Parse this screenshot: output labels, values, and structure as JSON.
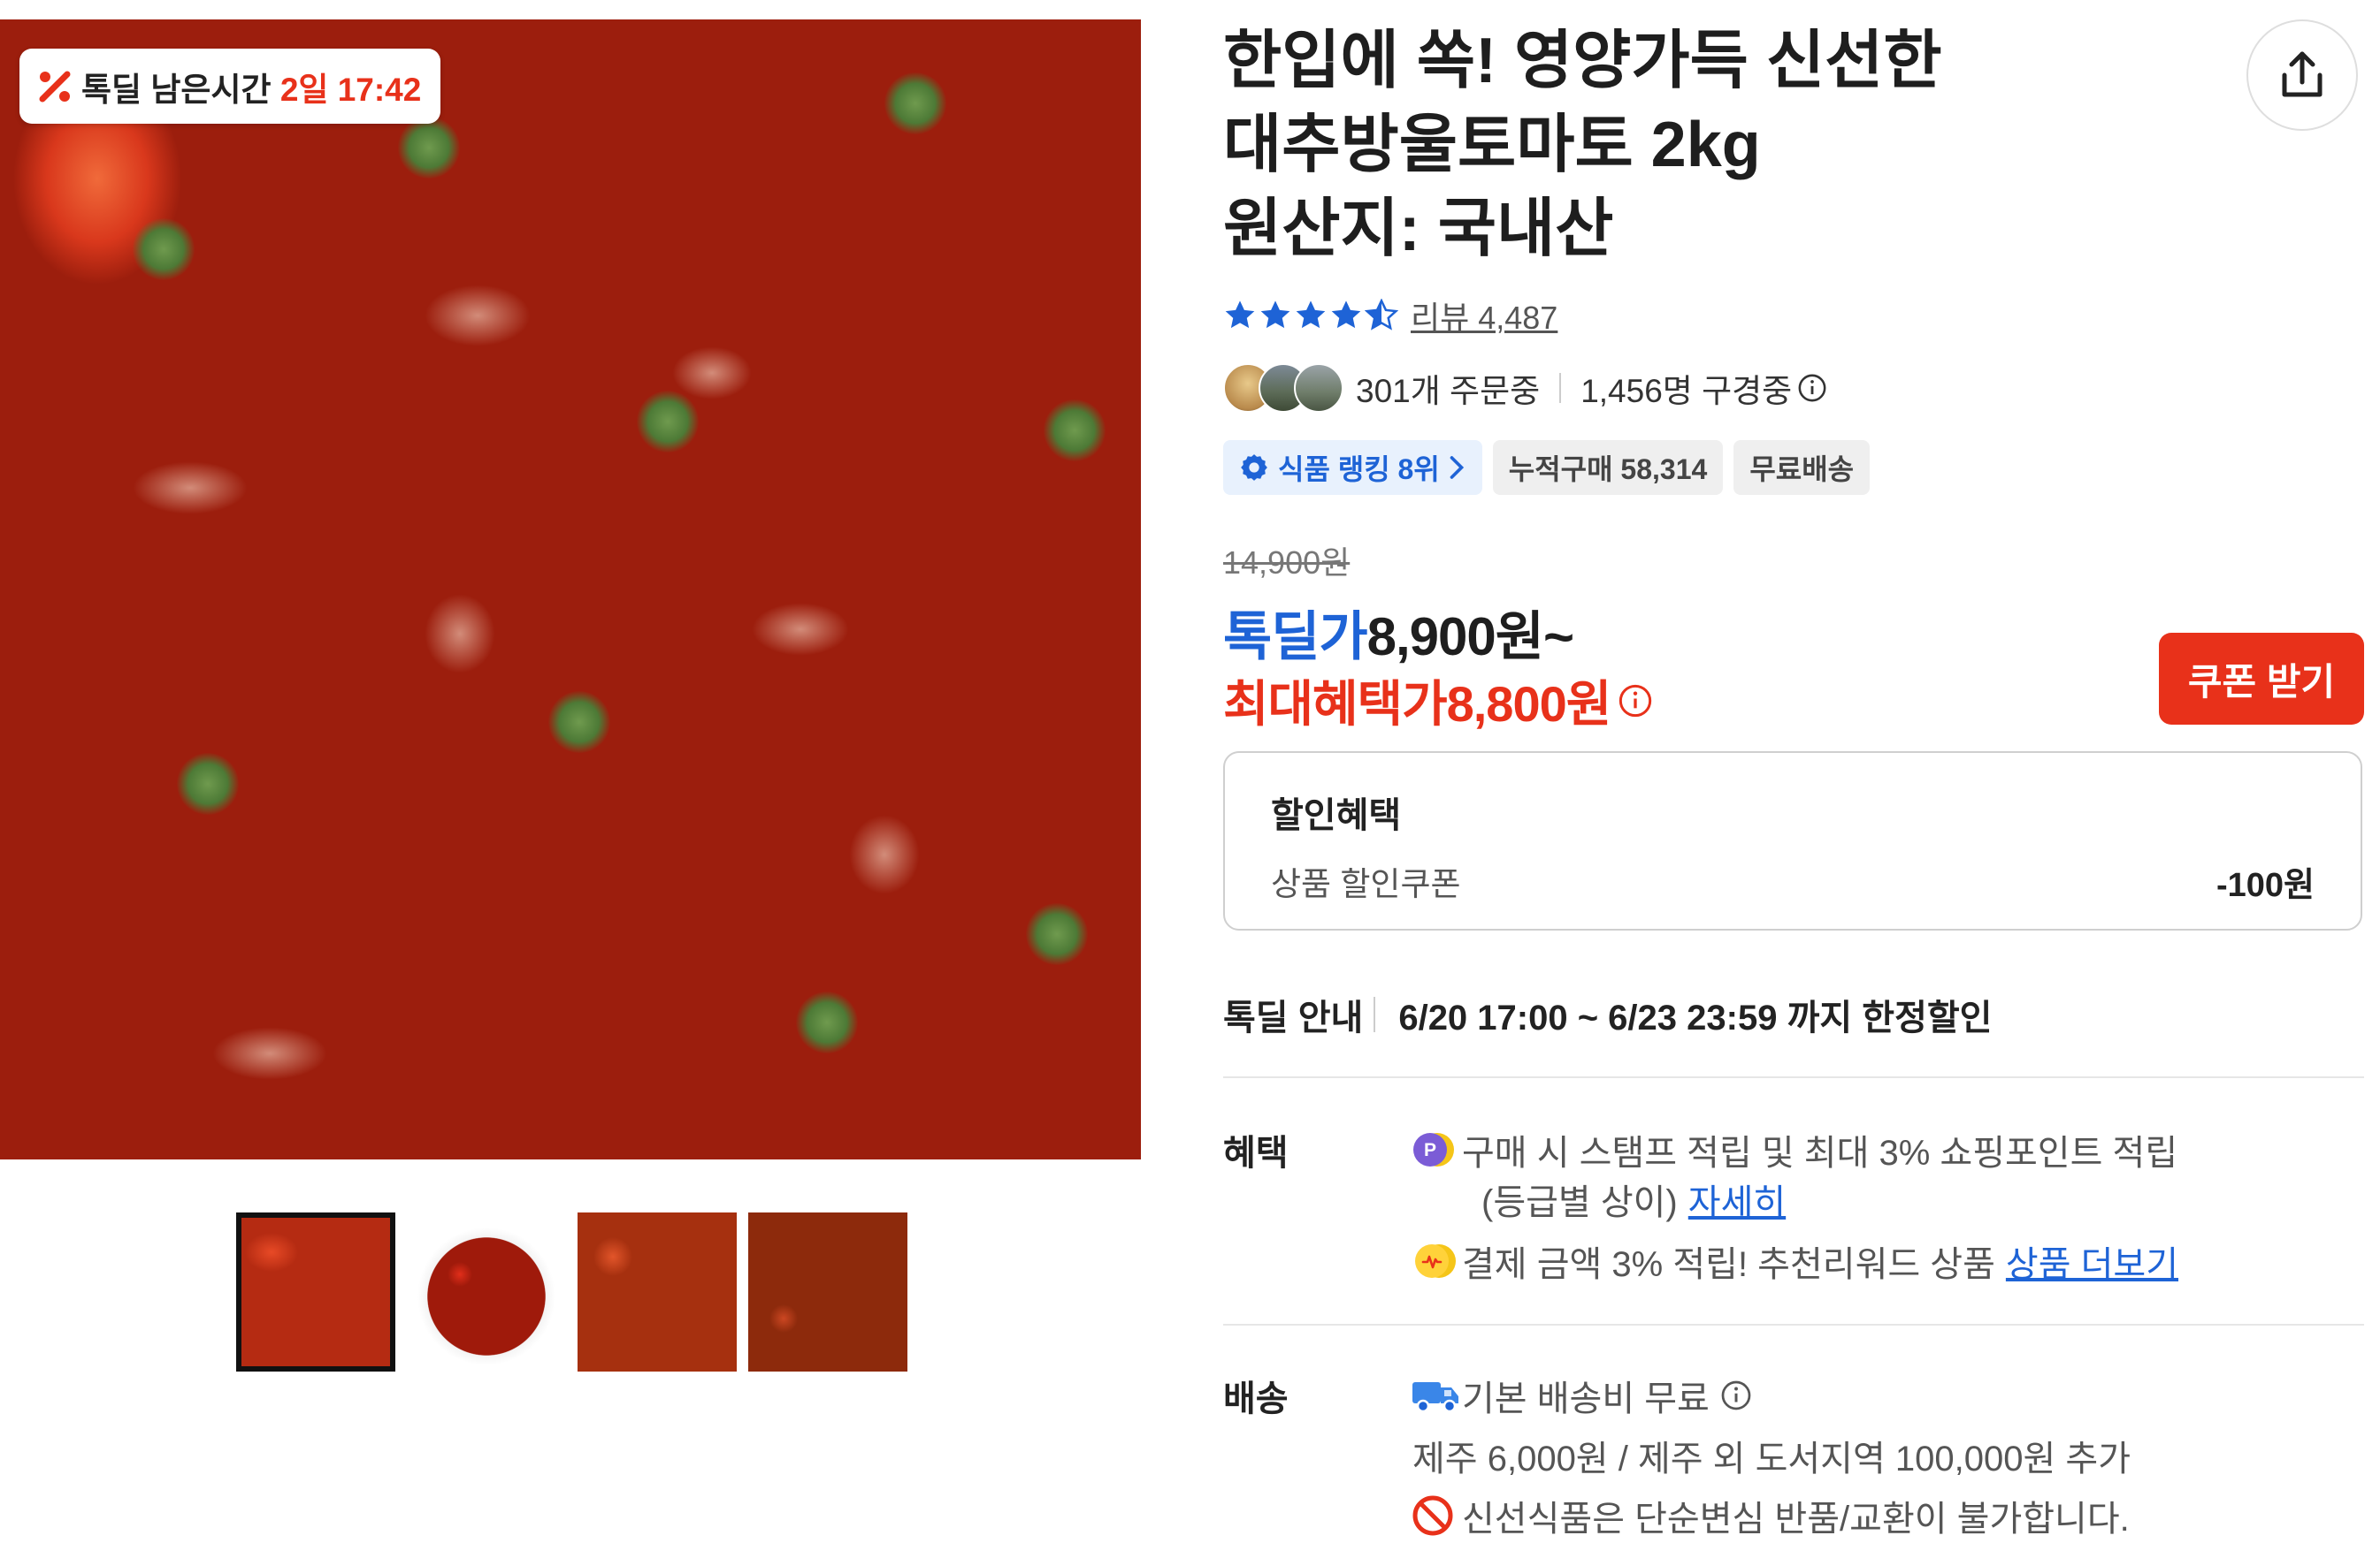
{
  "gallery": {
    "deal_badge": {
      "label": "톡딜 남은시간 ",
      "time": "2일 17:42",
      "icon": "talkdeal-percent-icon"
    },
    "main_image_alt": "대추방울토마토",
    "thumbnails": [
      "thumbnail-1",
      "thumbnail-2",
      "thumbnail-3",
      "thumbnail-4"
    ],
    "selected_thumbnail": 1
  },
  "product": {
    "title_lines": [
      "한입에 쏙! 영양가득 신선한",
      "대추방울토마토 2kg",
      "원산지: 국내산"
    ],
    "rating": 4.5,
    "review_label": "리뷰 4,487",
    "ordering": "301개 주문중",
    "viewing": "1,456명 구경중",
    "badges": {
      "ranking": "식품 랭킹 8위",
      "cumulative": "누적구매 58,314",
      "shipping": "무료배송"
    }
  },
  "price": {
    "original": "14,900원",
    "deal_label": "톡딜가",
    "deal_value": "8,900원~",
    "max_benefit": "최대혜택가8,800원",
    "coupon_button": "쿠폰 받기"
  },
  "discount": {
    "title": "할인혜택",
    "item_label": "상품 할인쿠폰",
    "item_amount": "-100원"
  },
  "talkdeal_info": {
    "label": "톡딜 안내",
    "period": "6/20 17:00 ~ 6/23 23:59 까지 한정할인"
  },
  "benefits": {
    "label": "혜택",
    "line1": "구매 시 스탬프 적립 및 최대 3% 쇼핑포인트 적립",
    "line1b": "(등급별 상이)",
    "line1_link": "자세히",
    "line2": "결제 금액 3% 적립! 추천리워드 상품",
    "line2_link": "상품 더보기"
  },
  "delivery": {
    "label": "배송",
    "fee": "기본 배송비 무료",
    "extra": "제주 6,000원 / 제주 외 도서지역 100,000원 추가",
    "notice": "신선식품은 단순변심 반품/교환이 불가합니다."
  },
  "colors": {
    "blue": "#1e63d6",
    "red": "#e8311a",
    "text": "#222222"
  }
}
